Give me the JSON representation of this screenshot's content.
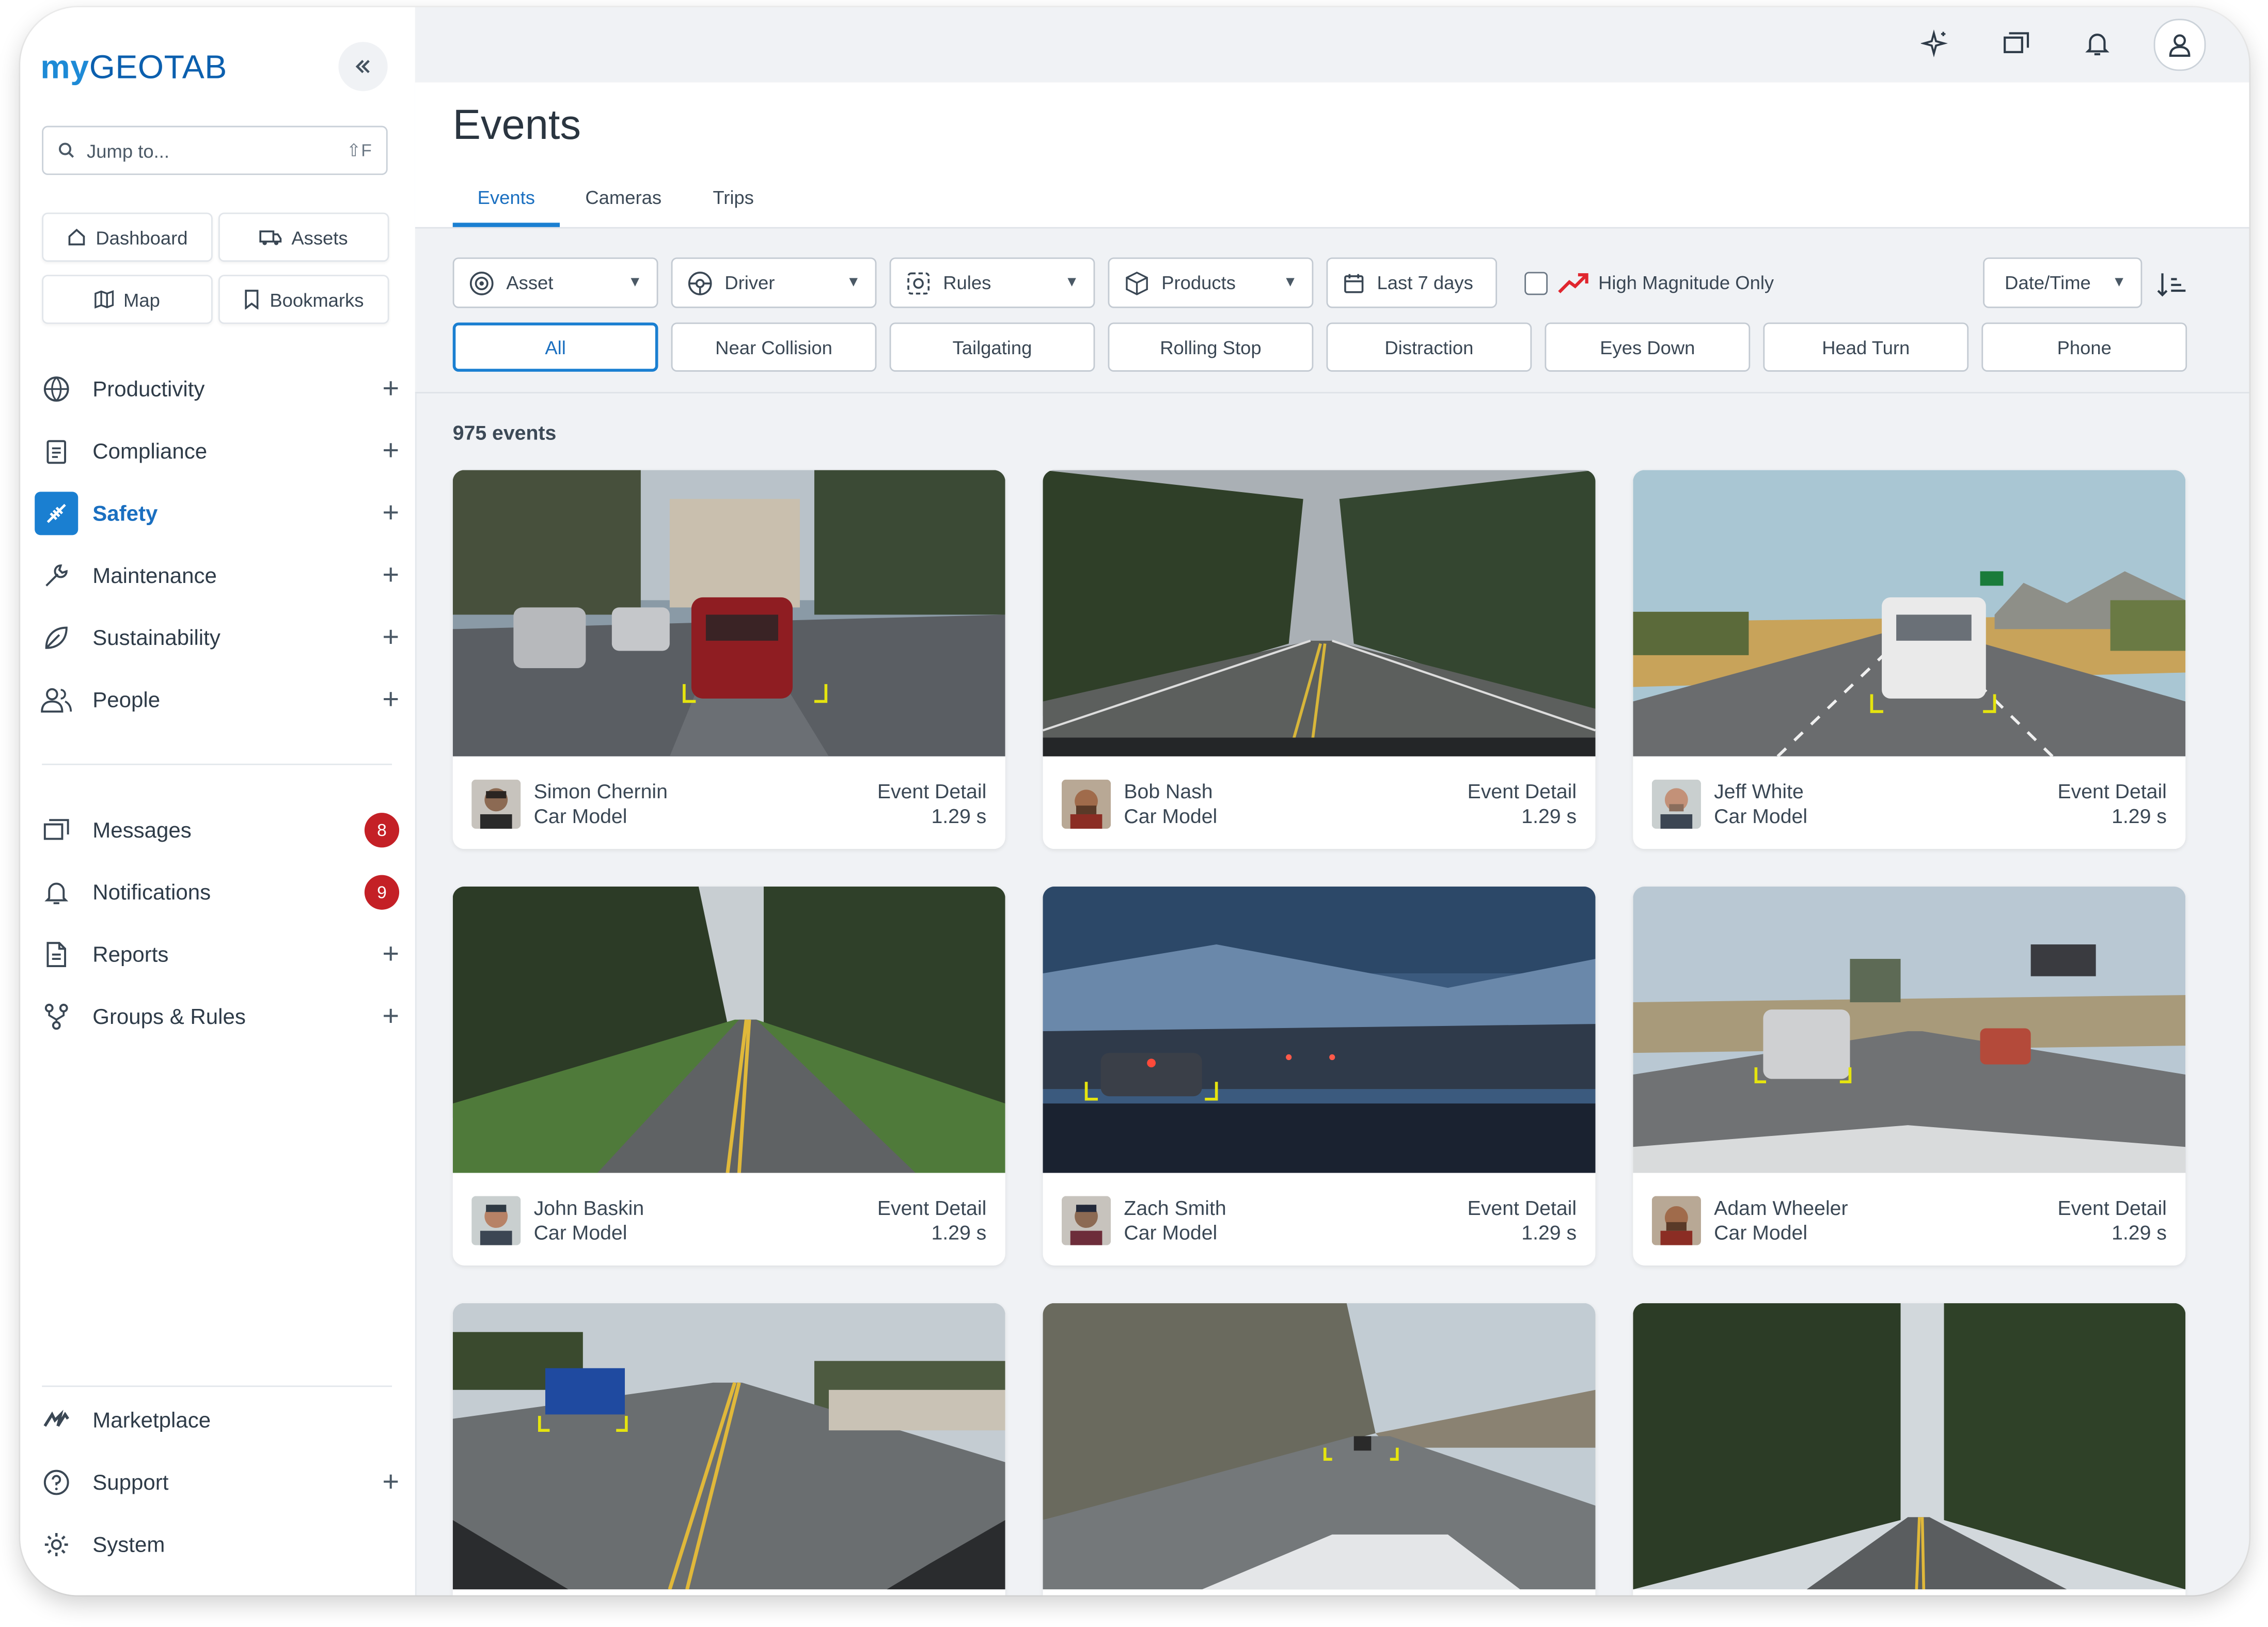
{
  "brand": {
    "logo_prefix": "my",
    "logo_main": "GEOTAB"
  },
  "sidebar": {
    "search": {
      "placeholder": "Jump to...",
      "shortcut": "⇧F"
    },
    "quick_links": [
      "Dashboard",
      "Assets",
      "Map",
      "Bookmarks"
    ],
    "nav": [
      {
        "label": "Productivity",
        "icon": "globe-icon",
        "active": false
      },
      {
        "label": "Compliance",
        "icon": "clipboard-icon",
        "active": false
      },
      {
        "label": "Safety",
        "icon": "safety-icon",
        "active": true
      },
      {
        "label": "Maintenance",
        "icon": "wrench-icon",
        "active": false
      },
      {
        "label": "Sustainability",
        "icon": "leaf-icon",
        "active": false
      },
      {
        "label": "People",
        "icon": "people-icon",
        "active": false
      }
    ],
    "nav2": [
      {
        "label": "Messages",
        "badge": "8"
      },
      {
        "label": "Notifications",
        "badge": "9"
      },
      {
        "label": "Reports"
      },
      {
        "label": "Groups & Rules"
      }
    ],
    "nav3": [
      {
        "label": "Marketplace"
      },
      {
        "label": "Support"
      },
      {
        "label": "System"
      }
    ]
  },
  "page": {
    "title": "Events",
    "tabs": [
      "Events",
      "Cameras",
      "Trips"
    ],
    "active_tab": "Events"
  },
  "filters": {
    "dropdowns": [
      "Asset",
      "Driver",
      "Rules",
      "Products"
    ],
    "date_range": "Last 7 days",
    "high_magnitude_label": "High Magnitude Only",
    "high_magnitude_checked": false,
    "sort_label": "Date/Time",
    "types": [
      "All",
      "Near Collision",
      "Tailgating",
      "Rolling Stop",
      "Distraction",
      "Eyes Down",
      "Head Turn",
      "Phone"
    ],
    "active_type": "All"
  },
  "events_count": "975 events",
  "events": [
    {
      "driver": "Simon Chernin",
      "vehicle": "Car Model",
      "label": "Event Detail",
      "duration": "1.29 s"
    },
    {
      "driver": "Bob Nash",
      "vehicle": "Car Model",
      "label": "Event Detail",
      "duration": "1.29 s"
    },
    {
      "driver": "Jeff White",
      "vehicle": "Car Model",
      "label": "Event Detail",
      "duration": "1.29 s"
    },
    {
      "driver": "John Baskin",
      "vehicle": "Car Model",
      "label": "Event Detail",
      "duration": "1.29 s"
    },
    {
      "driver": "Zach Smith",
      "vehicle": "Car Model",
      "label": "Event Detail",
      "duration": "1.29 s"
    },
    {
      "driver": "Adam Wheeler",
      "vehicle": "Car Model",
      "label": "Event Detail",
      "duration": "1.29 s"
    }
  ],
  "colors": {
    "accent": "#1a7fd1",
    "badge": "#c42026",
    "surface": "#f0f2f5",
    "magnitude": "#e0262e"
  }
}
